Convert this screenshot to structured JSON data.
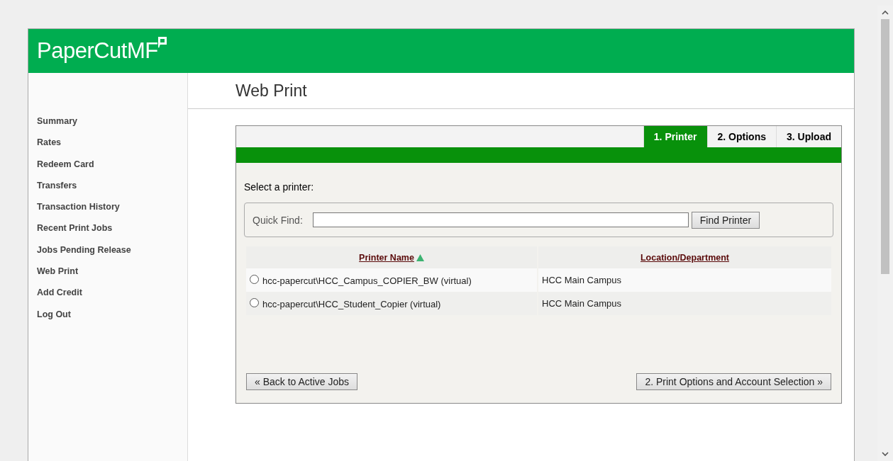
{
  "logo": {
    "name": "PaperCut",
    "suffix": "MF"
  },
  "sidebar": {
    "items": [
      {
        "label": "Summary",
        "selected": false
      },
      {
        "label": "Rates",
        "selected": false
      },
      {
        "label": "Redeem Card",
        "selected": false
      },
      {
        "label": "Transfers",
        "selected": false
      },
      {
        "label": "Transaction History",
        "selected": false
      },
      {
        "label": "Recent Print Jobs",
        "selected": false
      },
      {
        "label": "Jobs Pending Release",
        "selected": false
      },
      {
        "label": "Web Print",
        "selected": false
      },
      {
        "label": "Add Credit",
        "selected": false
      },
      {
        "label": "Log Out",
        "selected": false
      }
    ]
  },
  "page_title": "Web Print",
  "steps": [
    {
      "label": "1. Printer",
      "selected": true
    },
    {
      "label": "2. Options",
      "selected": false
    },
    {
      "label": "3. Upload",
      "selected": false
    }
  ],
  "prompt": "Select a printer:",
  "quick_find": {
    "label": "Quick Find:",
    "button": "Find Printer"
  },
  "table": {
    "columns": [
      {
        "label": "Printer Name",
        "sorted": true
      },
      {
        "label": "Location/Department",
        "sorted": false
      }
    ],
    "rows": [
      {
        "name": "hcc-papercut\\HCC_Campus_COPIER_BW (virtual)",
        "location": "HCC Main Campus",
        "selected": false
      },
      {
        "name": "hcc-papercut\\HCC_Student_Copier (virtual)",
        "location": "HCC Main Campus",
        "selected": false
      }
    ]
  },
  "buttons": {
    "back": "« Back to Active Jobs",
    "next": "2. Print Options and Account Selection »"
  }
}
